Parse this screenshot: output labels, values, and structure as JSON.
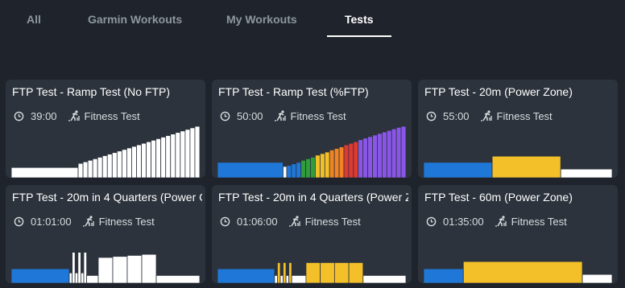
{
  "tabs": [
    {
      "label": "All"
    },
    {
      "label": "Garmin Workouts"
    },
    {
      "label": "My Workouts"
    },
    {
      "label": "Tests"
    }
  ],
  "active_tab": "Tests",
  "cards": [
    {
      "title": "FTP Test - Ramp Test (No FTP)",
      "duration": "39:00",
      "category": "Fitness Test",
      "profile": [
        {
          "duration": 55,
          "intensity": 0.2,
          "color": "#ffffff"
        },
        {
          "duration": 4,
          "intensity": 0.28,
          "color": "#ffffff"
        },
        {
          "duration": 4,
          "intensity": 0.31,
          "color": "#ffffff"
        },
        {
          "duration": 4,
          "intensity": 0.34,
          "color": "#ffffff"
        },
        {
          "duration": 4,
          "intensity": 0.37,
          "color": "#ffffff"
        },
        {
          "duration": 4,
          "intensity": 0.4,
          "color": "#ffffff"
        },
        {
          "duration": 4,
          "intensity": 0.43,
          "color": "#ffffff"
        },
        {
          "duration": 4,
          "intensity": 0.46,
          "color": "#ffffff"
        },
        {
          "duration": 4,
          "intensity": 0.49,
          "color": "#ffffff"
        },
        {
          "duration": 4,
          "intensity": 0.52,
          "color": "#ffffff"
        },
        {
          "duration": 4,
          "intensity": 0.55,
          "color": "#ffffff"
        },
        {
          "duration": 4,
          "intensity": 0.58,
          "color": "#ffffff"
        },
        {
          "duration": 4,
          "intensity": 0.61,
          "color": "#ffffff"
        },
        {
          "duration": 4,
          "intensity": 0.64,
          "color": "#ffffff"
        },
        {
          "duration": 4,
          "intensity": 0.67,
          "color": "#ffffff"
        },
        {
          "duration": 4,
          "intensity": 0.7,
          "color": "#ffffff"
        },
        {
          "duration": 4,
          "intensity": 0.73,
          "color": "#ffffff"
        },
        {
          "duration": 4,
          "intensity": 0.76,
          "color": "#ffffff"
        },
        {
          "duration": 4,
          "intensity": 0.79,
          "color": "#ffffff"
        },
        {
          "duration": 4,
          "intensity": 0.82,
          "color": "#ffffff"
        },
        {
          "duration": 4,
          "intensity": 0.85,
          "color": "#ffffff"
        },
        {
          "duration": 4,
          "intensity": 0.88,
          "color": "#ffffff"
        },
        {
          "duration": 4,
          "intensity": 0.91,
          "color": "#ffffff"
        },
        {
          "duration": 4,
          "intensity": 0.94,
          "color": "#ffffff"
        },
        {
          "duration": 4,
          "intensity": 0.97,
          "color": "#ffffff"
        },
        {
          "duration": 4,
          "intensity": 1.0,
          "color": "#ffffff"
        }
      ]
    },
    {
      "title": "FTP Test - Ramp Test (%FTP)",
      "duration": "50:00",
      "category": "Fitness Test",
      "profile": [
        {
          "duration": 55,
          "intensity": 0.3,
          "color": "#1f77d8"
        },
        {
          "duration": 3,
          "intensity": 0.22,
          "color": "#ffffff"
        },
        {
          "duration": 4,
          "intensity": 0.24,
          "color": "#1f77d8"
        },
        {
          "duration": 4,
          "intensity": 0.27,
          "color": "#1f77d8"
        },
        {
          "duration": 4,
          "intensity": 0.3,
          "color": "#1f77d8"
        },
        {
          "duration": 4,
          "intensity": 0.34,
          "color": "#2e9d3a"
        },
        {
          "duration": 4,
          "intensity": 0.37,
          "color": "#2e9d3a"
        },
        {
          "duration": 4,
          "intensity": 0.4,
          "color": "#2e9d3a"
        },
        {
          "duration": 4,
          "intensity": 0.44,
          "color": "#f4c029"
        },
        {
          "duration": 4,
          "intensity": 0.47,
          "color": "#f4c029"
        },
        {
          "duration": 4,
          "intensity": 0.5,
          "color": "#f4c029"
        },
        {
          "duration": 4,
          "intensity": 0.54,
          "color": "#f08424"
        },
        {
          "duration": 4,
          "intensity": 0.57,
          "color": "#f08424"
        },
        {
          "duration": 4,
          "intensity": 0.6,
          "color": "#f08424"
        },
        {
          "duration": 4,
          "intensity": 0.64,
          "color": "#dd3a32"
        },
        {
          "duration": 4,
          "intensity": 0.67,
          "color": "#dd3a32"
        },
        {
          "duration": 4,
          "intensity": 0.7,
          "color": "#dd3a32"
        },
        {
          "duration": 4,
          "intensity": 0.74,
          "color": "#8a56e8"
        },
        {
          "duration": 4,
          "intensity": 0.77,
          "color": "#8a56e8"
        },
        {
          "duration": 4,
          "intensity": 0.8,
          "color": "#8a56e8"
        },
        {
          "duration": 4,
          "intensity": 0.83,
          "color": "#8a56e8"
        },
        {
          "duration": 4,
          "intensity": 0.86,
          "color": "#8a56e8"
        },
        {
          "duration": 4,
          "intensity": 0.89,
          "color": "#8a56e8"
        },
        {
          "duration": 4,
          "intensity": 0.92,
          "color": "#8a56e8"
        },
        {
          "duration": 4,
          "intensity": 0.95,
          "color": "#8a56e8"
        },
        {
          "duration": 4,
          "intensity": 0.98,
          "color": "#8a56e8"
        },
        {
          "duration": 4,
          "intensity": 1.0,
          "color": "#8a56e8"
        }
      ]
    },
    {
      "title": "FTP Test - 20m (Power Zone)",
      "duration": "55:00",
      "category": "Fitness Test",
      "profile": [
        {
          "duration": 20,
          "intensity": 0.3,
          "color": "#1f77d8"
        },
        {
          "duration": 20,
          "intensity": 0.42,
          "color": "#f4c029"
        },
        {
          "duration": 15,
          "intensity": 0.17,
          "color": "#ffffff"
        }
      ]
    },
    {
      "title": "FTP Test - 20m in 4 Quarters (Power C",
      "duration": "01:01:00",
      "category": "Fitness Test",
      "profile": [
        {
          "duration": 20,
          "intensity": 0.28,
          "color": "#1f77d8"
        },
        {
          "duration": 1,
          "intensity": 0.2,
          "color": "#ffffff"
        },
        {
          "duration": 1,
          "intensity": 0.6,
          "color": "#ffffff"
        },
        {
          "duration": 1,
          "intensity": 0.2,
          "color": "#ffffff"
        },
        {
          "duration": 1,
          "intensity": 0.6,
          "color": "#ffffff"
        },
        {
          "duration": 1,
          "intensity": 0.2,
          "color": "#ffffff"
        },
        {
          "duration": 1,
          "intensity": 0.6,
          "color": "#ffffff"
        },
        {
          "duration": 4,
          "intensity": 0.15,
          "color": "#ffffff"
        },
        {
          "duration": 5,
          "intensity": 0.5,
          "color": "#ffffff"
        },
        {
          "duration": 5,
          "intensity": 0.52,
          "color": "#ffffff"
        },
        {
          "duration": 5,
          "intensity": 0.54,
          "color": "#ffffff"
        },
        {
          "duration": 5,
          "intensity": 0.56,
          "color": "#ffffff"
        },
        {
          "duration": 15,
          "intensity": 0.15,
          "color": "#ffffff"
        }
      ]
    },
    {
      "title": "FTP Test - 20m in 4 Quarters (Power Z",
      "duration": "01:06:00",
      "category": "Fitness Test",
      "profile": [
        {
          "duration": 20,
          "intensity": 0.28,
          "color": "#1f77d8"
        },
        {
          "duration": 1,
          "intensity": 0.15,
          "color": "#ffffff"
        },
        {
          "duration": 1,
          "intensity": 0.4,
          "color": "#f4c029"
        },
        {
          "duration": 1,
          "intensity": 0.15,
          "color": "#ffffff"
        },
        {
          "duration": 1,
          "intensity": 0.4,
          "color": "#f4c029"
        },
        {
          "duration": 1,
          "intensity": 0.15,
          "color": "#ffffff"
        },
        {
          "duration": 1,
          "intensity": 0.4,
          "color": "#f4c029"
        },
        {
          "duration": 5,
          "intensity": 0.15,
          "color": "#ffffff"
        },
        {
          "duration": 5,
          "intensity": 0.4,
          "color": "#f4c029"
        },
        {
          "duration": 5,
          "intensity": 0.4,
          "color": "#f4c029"
        },
        {
          "duration": 5,
          "intensity": 0.4,
          "color": "#f4c029"
        },
        {
          "duration": 5,
          "intensity": 0.4,
          "color": "#f4c029"
        },
        {
          "duration": 15,
          "intensity": 0.15,
          "color": "#ffffff"
        }
      ]
    },
    {
      "title": "FTP Test - 60m (Power Zone)",
      "duration": "01:35:00",
      "category": "Fitness Test",
      "profile": [
        {
          "duration": 20,
          "intensity": 0.28,
          "color": "#1f77d8"
        },
        {
          "duration": 60,
          "intensity": 0.42,
          "color": "#f4c029"
        },
        {
          "duration": 15,
          "intensity": 0.17,
          "color": "#ffffff"
        }
      ]
    }
  ]
}
